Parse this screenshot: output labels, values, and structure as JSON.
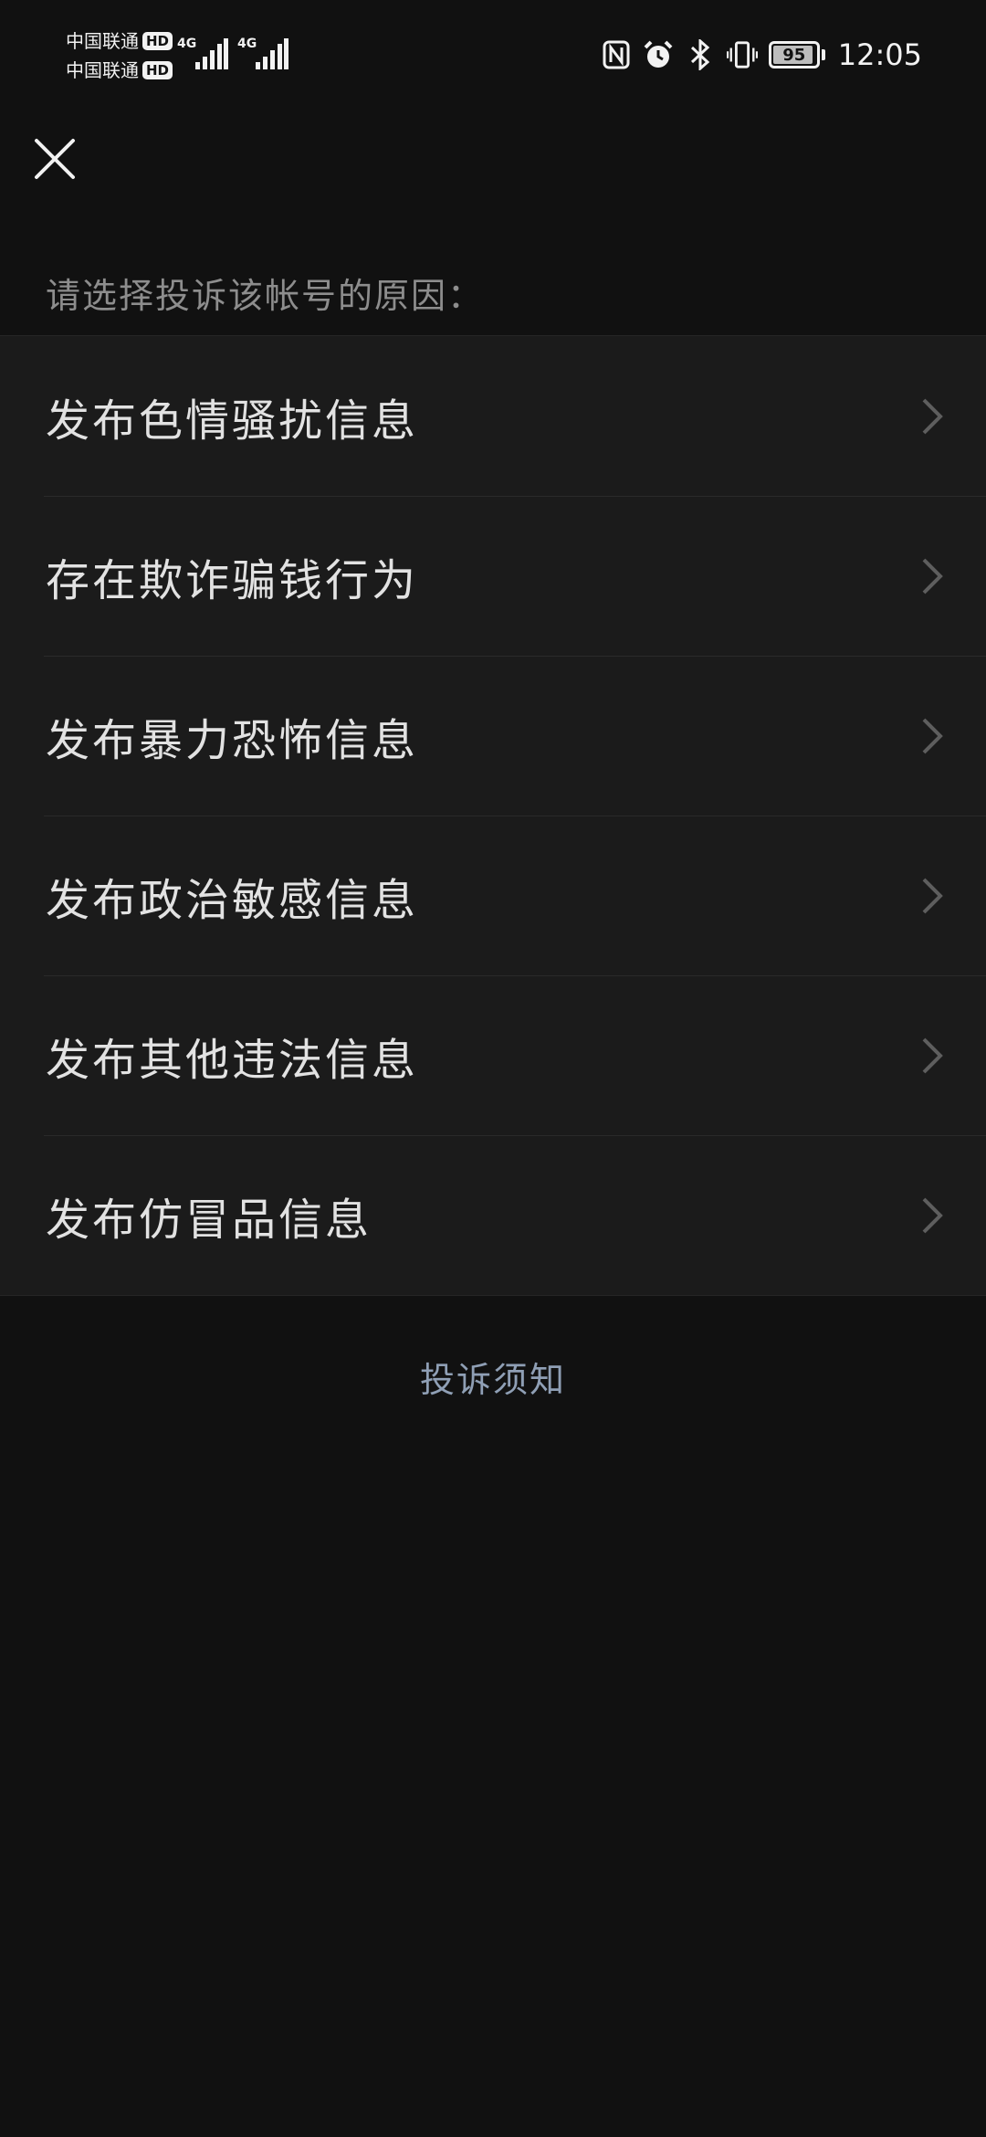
{
  "status_bar": {
    "carriers": [
      {
        "name": "中国联通",
        "badge": "HD"
      },
      {
        "name": "中国联通",
        "badge": "HD"
      }
    ],
    "networks": [
      "4G",
      "4G"
    ],
    "battery_level": "95",
    "time": "12:05"
  },
  "header": {
    "close_icon": "close-icon"
  },
  "prompt": "请选择投诉该帐号的原因：",
  "reasons": [
    {
      "label": "发布色情骚扰信息"
    },
    {
      "label": "存在欺诈骗钱行为"
    },
    {
      "label": "发布暴力恐怖信息"
    },
    {
      "label": "发布政治敏感信息"
    },
    {
      "label": "发布其他违法信息"
    },
    {
      "label": "发布仿冒品信息"
    }
  ],
  "footer": {
    "notice_link": "投诉须知"
  },
  "colors": {
    "background": "#111111",
    "list_background": "#1b1b1b",
    "text_primary": "#e2e2e2",
    "text_secondary": "#8d8d8d",
    "link": "#8f9fb5"
  }
}
